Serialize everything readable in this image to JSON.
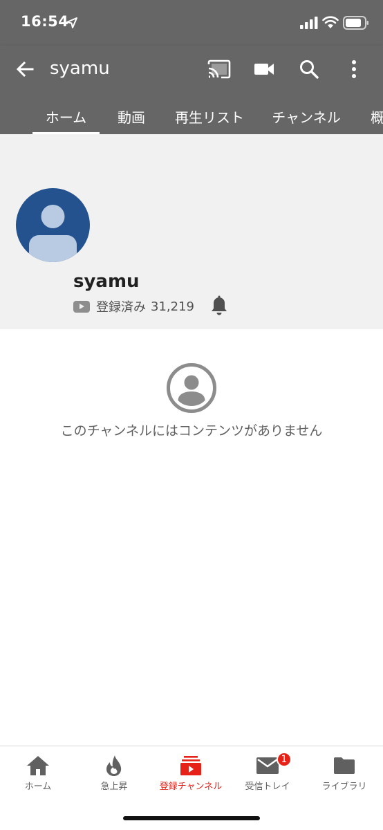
{
  "status_bar": {
    "time": "16:54",
    "icons": [
      "location-arrow-icon",
      "signal-icon",
      "wifi-icon",
      "battery-icon"
    ]
  },
  "app_bar": {
    "title": "syamu",
    "back_icon": "arrow-back-icon",
    "action_icons": [
      "cast-icon",
      "video-camera-icon",
      "search-icon",
      "more-vert-icon"
    ],
    "tabs": [
      "ホーム",
      "動画",
      "再生リスト",
      "チャンネル",
      "概要"
    ],
    "active_tab": "ホーム"
  },
  "channel": {
    "name": "syamu",
    "subscribed_label": "登録済み",
    "subscriber_count": "31,219",
    "bell_icon": "bell-icon"
  },
  "empty_state": {
    "icon": "account-circle-icon",
    "message": "このチャンネルにはコンテンツがありません"
  },
  "bottom_nav": {
    "items": [
      {
        "label": "ホーム",
        "icon": "home-icon"
      },
      {
        "label": "急上昇",
        "icon": "flame-icon"
      },
      {
        "label": "登録チャンネル",
        "icon": "subscriptions-icon",
        "active": true
      },
      {
        "label": "受信トレイ",
        "icon": "mail-icon",
        "badge": "1"
      },
      {
        "label": "ライブラリ",
        "icon": "folder-icon"
      }
    ]
  },
  "colors": {
    "app_bar": "#666666",
    "header_bg": "#f1f1f1",
    "avatar_bg": "#23528f",
    "accent": "#e62117"
  }
}
